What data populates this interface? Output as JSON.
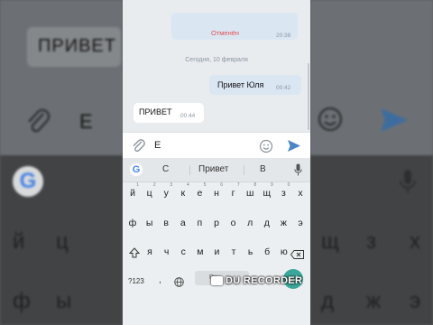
{
  "chat": {
    "cancelled_label": "Отменён",
    "cancelled_time": "20:38",
    "date_separator": "Сегодня, 10 февраля",
    "outgoing": {
      "text": "Привет Юля",
      "time": "00:42"
    },
    "incoming": {
      "text": "ПРИВЕТ",
      "time": "00:44"
    }
  },
  "composer": {
    "value": "Е",
    "attach_icon": "paperclip-icon",
    "emoji_icon": "smile-icon",
    "send_icon": "send-icon"
  },
  "keyboard": {
    "suggestions": [
      "С",
      "Привет",
      "В"
    ],
    "row1": [
      "й",
      "ц",
      "у",
      "к",
      "е",
      "н",
      "г",
      "ш",
      "щ",
      "з",
      "х"
    ],
    "row1_hints": [
      "1",
      "2",
      "3",
      "4",
      "5",
      "6",
      "7",
      "8",
      "9",
      "0",
      ""
    ],
    "row2": [
      "ф",
      "ы",
      "в",
      "а",
      "п",
      "р",
      "о",
      "л",
      "д",
      "ж",
      "э"
    ],
    "row3": [
      "я",
      "ч",
      "с",
      "м",
      "и",
      "т",
      "ь",
      "б",
      "ю"
    ],
    "symbols_key": "?123",
    "comma_key": ",",
    "space_label": "Ру",
    "accent_color": "#3aa69a"
  },
  "background": {
    "left_text": "ПРИВЕТ",
    "left_field": "Е",
    "left_keys_row1": [
      "й",
      "ц"
    ],
    "left_keys_row2": [
      "ф",
      "ы"
    ],
    "right_keys_row1": [
      "щ",
      "з",
      "х"
    ],
    "right_keys_row2": [
      "д",
      "ж",
      "э"
    ]
  },
  "watermark": {
    "text": "DU RECORDER"
  }
}
